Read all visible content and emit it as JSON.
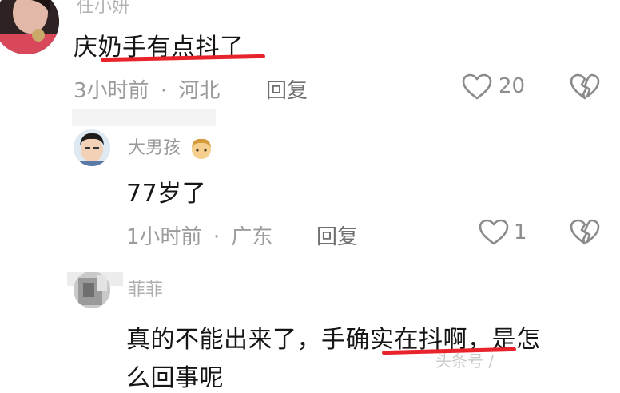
{
  "comments": [
    {
      "name": "任小妍",
      "text": "庆奶手有点抖了",
      "time": "3小时前",
      "sep": "·",
      "location": "河北",
      "reply_label": "回复",
      "likes": "20"
    },
    {
      "name": "大男孩",
      "text": "77岁了",
      "time": "1小时前",
      "sep": "·",
      "location": "广东",
      "reply_label": "回复",
      "likes": "1"
    },
    {
      "name": "菲菲",
      "text_line1": "真的不能出来了，手确实在抖啊，是怎",
      "text_line2": "么回事呢"
    }
  ],
  "watermark": "头条号 / ",
  "colors": {
    "text": "#161616",
    "meta": "#9b9b9b",
    "underline": "#e8232c",
    "icon": "#8a8a8a"
  },
  "icons": [
    "heart-outline-icon",
    "broken-heart-icon",
    "man-emoji-icon"
  ]
}
